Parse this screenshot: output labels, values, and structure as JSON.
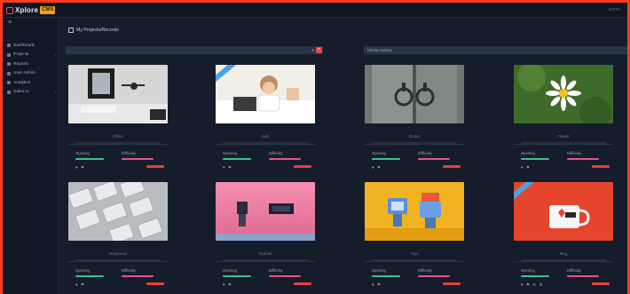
{
  "header": {
    "logo_text": "Xplore",
    "logo_badge": "CMS",
    "right_text": "admin"
  },
  "sidebar": {
    "toggle_icon": "menu-icon",
    "items": [
      {
        "label": "Dashboard",
        "caret": ""
      },
      {
        "label": "Projects",
        "caret": "›"
      },
      {
        "label": "Reports",
        "caret": ""
      },
      {
        "label": "User Admin",
        "caret": ""
      },
      {
        "label": "Analytics",
        "caret": ""
      },
      {
        "label": "Sales ro",
        "caret": "›"
      }
    ]
  },
  "page": {
    "title": "My Projects/Records"
  },
  "panels": {
    "left_label": "",
    "right_label": "Media Gallery",
    "search_icon": "search-icon",
    "close_glyph": "×"
  },
  "cards": [
    {
      "caption": "Office",
      "stat_left": "Opening",
      "stat_right": "Difficulty",
      "icons": "♥ ⚑",
      "ribbon": false
    },
    {
      "caption": "Kids",
      "stat_left": "Opening",
      "stat_right": "Difficulty",
      "icons": "♥ ⚑",
      "ribbon": true
    },
    {
      "caption": "Doors",
      "stat_left": "Opening",
      "stat_right": "Difficulty",
      "icons": "♥ ⚑",
      "ribbon": false
    },
    {
      "caption": "Flower",
      "stat_left": "Opening",
      "stat_right": "Difficulty",
      "icons": "♥ ⚑",
      "ribbon": false
    },
    {
      "caption": "Keyboard",
      "stat_left": "Opening",
      "stat_right": "Difficulty",
      "icons": "♥ ⚑",
      "ribbon": false
    },
    {
      "caption": "Robots",
      "stat_left": "Opening",
      "stat_right": "Difficulty",
      "icons": "♥ ⚑",
      "ribbon": false
    },
    {
      "caption": "Toys",
      "stat_left": "Opening",
      "stat_right": "Difficulty",
      "icons": "♥ ⚑",
      "ribbon": false
    },
    {
      "caption": "Mug",
      "stat_left": "Opening",
      "stat_right": "Difficulty",
      "icons": "♥ ⚑ ✉ ⚙",
      "ribbon": true
    }
  ],
  "colors": {
    "accent": "#ff3b1f",
    "danger": "#e8403a",
    "success": "#3ec08a",
    "pink": "#e25585"
  }
}
